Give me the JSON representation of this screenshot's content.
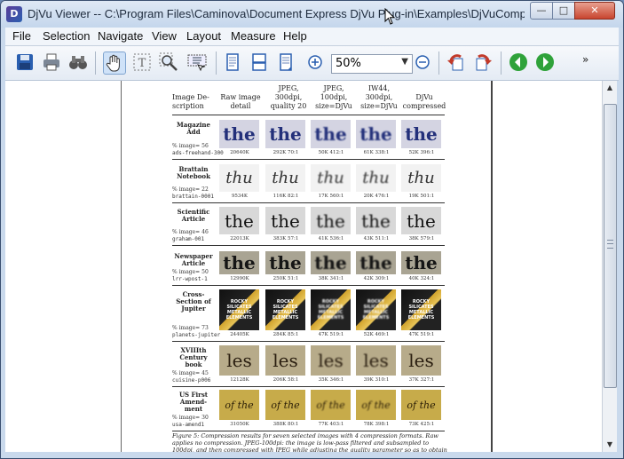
{
  "window": {
    "title": "DjVu Viewer -- C:\\Program Files\\Caminova\\Document Express DjVu Plug-in\\Examples\\DjVuComparison...",
    "controls": {
      "minimize": "—",
      "maximize": "□",
      "close": "✕"
    }
  },
  "menu": [
    "File",
    "Selection",
    "Navigate",
    "View",
    "Layout",
    "Measure",
    "Help"
  ],
  "toolbar": {
    "zoom_value": "50%",
    "icons": [
      "save-icon",
      "print-icon",
      "binoculars-icon",
      "hand-tool-icon",
      "text-select-icon",
      "zoom-select-icon",
      "region-select-icon",
      "single-page-icon",
      "continuous-page-icon",
      "facing-page-icon",
      "zoom-in-icon",
      "zoom-out-icon",
      "rotate-left-icon",
      "rotate-right-icon",
      "back-icon",
      "forward-icon",
      "more-chevron-icon"
    ],
    "colors": {
      "rotate": "#c23a2a",
      "nav": "#2fa23a",
      "zoom": "#2a5fb0"
    }
  },
  "document": {
    "headers": [
      "Image De-\nscription",
      "Raw image\ndetail",
      "JPEG,\n300dpi,\nquality 20",
      "JPEG,\n100dpi,\nsize=DjVu",
      "IW44,\n300dpi,\nsize=DjVu",
      "DjVu\ncompressed"
    ],
    "rows": [
      {
        "name": "Magazine Add",
        "pct": "% image= 56",
        "file": "ads-freehand-300",
        "word": "the",
        "style": "magazine",
        "caps": [
          "20640K",
          "292K 70:1",
          "50K 412:1",
          "61K 338:1",
          "52K 396:1"
        ]
      },
      {
        "name": "Brattain Notebook",
        "pct": "% image= 22",
        "file": "brattain-0001",
        "word": "thu",
        "style": "script",
        "caps": [
          "9534K",
          "116K 82:1",
          "17K 560:1",
          "20K 476:1",
          "19K 501:1"
        ]
      },
      {
        "name": "Scientific Article",
        "pct": "% image= 46",
        "file": "graham-001",
        "word": "the",
        "style": "gray",
        "caps": [
          "22013K",
          "383K 57:1",
          "41K 536:1",
          "43K 511:1",
          "38K 579:1"
        ]
      },
      {
        "name": "Newspaper Article",
        "pct": "% image= 50",
        "file": "lrr-wpost-1",
        "word": "the",
        "style": "paper",
        "caps": [
          "12990K",
          "250K 51:1",
          "38K 341:1",
          "42K 309:1",
          "40K 324:1"
        ]
      },
      {
        "name": "Cross-Section of Jupiter",
        "pct": "% image= 73",
        "file": "planets-jupiter",
        "word": "ROCKY SILICATES METALLIC ELEMENTS",
        "style": "jupiter",
        "caps": [
          "24405K",
          "284K 85:1",
          "47K 519:1",
          "52K 469:1",
          "47K 519:1"
        ]
      },
      {
        "name": "XVIIIth Century book",
        "pct": "% image= 45",
        "file": "cuisine-p006",
        "word": "les",
        "style": "book",
        "caps": [
          "12128K",
          "206K 58:1",
          "35K 346:1",
          "39K 310:1",
          "37K 327:1"
        ]
      },
      {
        "name": "US First Amend-ment",
        "pct": "% image= 30",
        "file": "usa-amend1",
        "word": "of the",
        "style": "amend",
        "caps": [
          "31050K",
          "388K 80:1",
          "77K 403:1",
          "78K 398:1",
          "73K 425:1"
        ]
      }
    ],
    "caption": "Figure 5: Compression results for seven selected images with 4 compression formats. Raw applies no compression. JPEG-100dpi: the image is low-pass filtered and subsampled to 100dpi, and then compressed with JPEG while adjusting the quality parameter so as to obtain a file approximately the same size as the"
  },
  "scrollbar": {
    "up": "▲",
    "down": "▼"
  }
}
